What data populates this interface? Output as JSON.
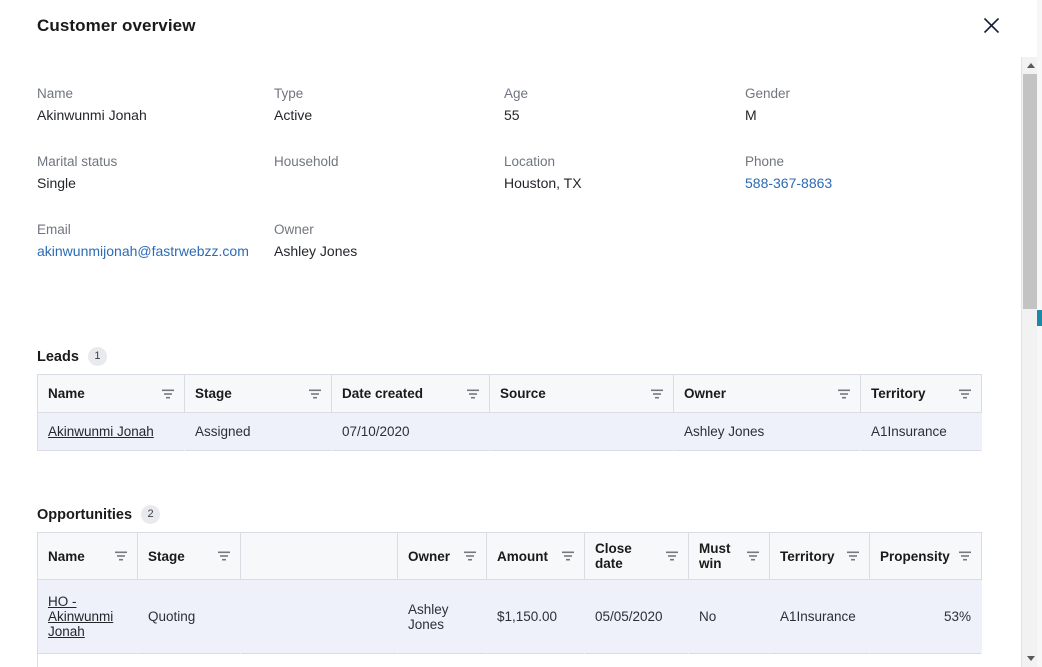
{
  "modal": {
    "title": "Customer overview",
    "close_icon": "close-icon"
  },
  "details": [
    [
      {
        "label": "Name",
        "value": "Akinwunmi Jonah",
        "link": false
      },
      {
        "label": "Type",
        "value": "Active",
        "link": false
      },
      {
        "label": "Age",
        "value": "55",
        "link": false
      },
      {
        "label": "Gender",
        "value": "M",
        "link": false
      }
    ],
    [
      {
        "label": "Marital status",
        "value": "Single",
        "link": false
      },
      {
        "label": "Household",
        "value": "",
        "link": false
      },
      {
        "label": "Location",
        "value": "Houston,  TX",
        "link": false
      },
      {
        "label": "Phone",
        "value": "588-367-8863",
        "link": true
      }
    ],
    [
      {
        "label": "Email",
        "value": "akinwunmijonah@fastrwebzz.com",
        "link": true
      },
      {
        "label": "Owner",
        "value": "Ashley Jones",
        "link": false
      },
      {
        "label": "",
        "value": "",
        "link": false
      },
      {
        "label": "",
        "value": "",
        "link": false
      }
    ]
  ],
  "leads": {
    "title": "Leads",
    "count": "1",
    "columns": [
      {
        "label": "Name",
        "filter": true
      },
      {
        "label": "Stage",
        "filter": true
      },
      {
        "label": "Date created",
        "filter": true
      },
      {
        "label": "Source",
        "filter": true
      },
      {
        "label": "Owner",
        "filter": true
      },
      {
        "label": "Territory",
        "filter": true
      }
    ],
    "rows": [
      {
        "name": "Akinwunmi Jonah",
        "stage": "Assigned",
        "date_created": "07/10/2020",
        "source": "",
        "owner": "Ashley Jones",
        "territory": "A1Insurance"
      }
    ]
  },
  "opportunities": {
    "title": "Opportunities",
    "count": "2",
    "columns": [
      {
        "label": "Name",
        "filter": true
      },
      {
        "label": "Stage",
        "filter": true
      },
      {
        "label": "",
        "filter": false
      },
      {
        "label": "Owner",
        "filter": true
      },
      {
        "label": "Amount",
        "filter": true
      },
      {
        "label": "Close date",
        "filter": true
      },
      {
        "label": "Must win",
        "filter": true
      },
      {
        "label": "Territory",
        "filter": true
      },
      {
        "label": "Propensity",
        "filter": true
      }
    ],
    "rows": [
      {
        "name": "HO - Akinwunmi Jonah",
        "stage": "Quoting",
        "blank": "",
        "owner": "Ashley Jones",
        "amount": "$1,150.00",
        "close_date": "05/05/2020",
        "must_win": "No",
        "territory": "A1Insurance",
        "propensity": "53%"
      }
    ]
  },
  "scrollbars": {
    "modal_up_icon": "arrow-up-icon",
    "modal_down_icon": "arrow-down-icon"
  },
  "colors": {
    "link": "#2c6bb5",
    "row_bg": "#eef1f9",
    "header_bg": "#f7f8fa",
    "border": "#d9dde3"
  }
}
